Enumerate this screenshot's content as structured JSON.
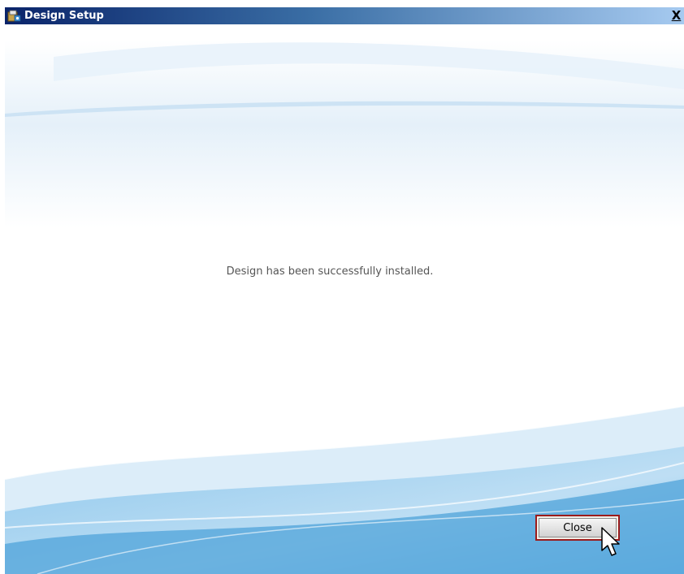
{
  "window": {
    "title": "Design Setup",
    "close_glyph": "X",
    "title_icon": "setup-icon"
  },
  "content": {
    "message": "Design has been successfully installed."
  },
  "footer": {
    "close_label": "Close"
  },
  "cursor": {
    "icon": "arrow-cursor-icon"
  },
  "colors": {
    "titlebar_start": "#0a246a",
    "titlebar_end": "#a6caf0",
    "wave_blue": "#5aa9de",
    "focus_border": "#9b1b1b"
  }
}
